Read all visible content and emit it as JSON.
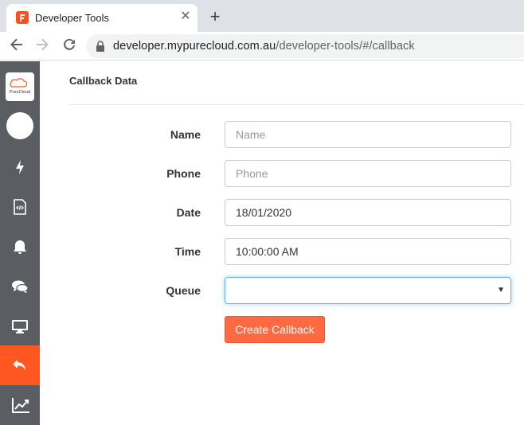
{
  "browser": {
    "tab_title": "Developer Tools",
    "tab_close": "✕",
    "new_tab": "+",
    "url_host": "developer.mypurecloud.com.au",
    "url_path": "/developer-tools/#/callback"
  },
  "sidebar": {
    "logo_text": "PureCloud",
    "items": [
      {
        "icon": "bolt-icon"
      },
      {
        "icon": "code-file-icon"
      },
      {
        "icon": "bell-icon"
      },
      {
        "icon": "chat-icon"
      },
      {
        "icon": "monitor-icon"
      },
      {
        "icon": "reply-icon",
        "active": true
      },
      {
        "icon": "chart-line-icon"
      }
    ],
    "accent": "#ff5722",
    "background": "#5a5d61"
  },
  "page": {
    "title": "Callback Data"
  },
  "form": {
    "name_label": "Name",
    "name_placeholder": "Name",
    "phone_label": "Phone",
    "phone_placeholder": "Phone",
    "date_label": "Date",
    "date_value": "18/01/2020",
    "time_label": "Time",
    "time_value": "10:00:00 AM",
    "queue_label": "Queue",
    "queue_value": "",
    "submit_label": "Create Callback",
    "submit_color": "#ff6a42"
  }
}
